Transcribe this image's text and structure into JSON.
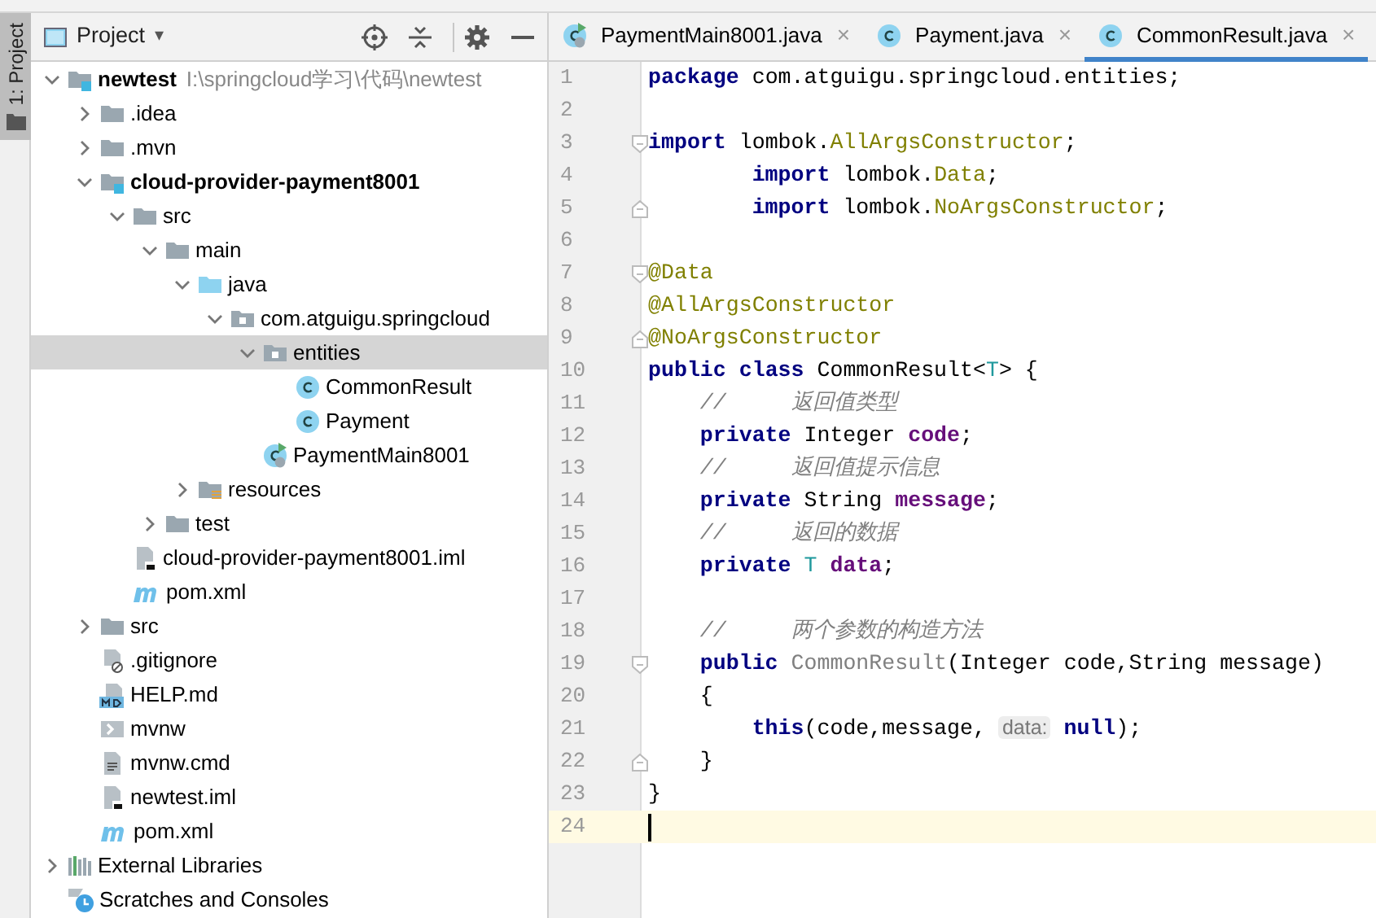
{
  "tool_strip": {
    "label": "1: Project",
    "selected": true
  },
  "project_panel": {
    "title": "Project",
    "caret": "▾",
    "tree": [
      {
        "label": "newtest",
        "path": "I:\\springcloud学习\\代码\\newtest",
        "kind": "module",
        "expanded": true,
        "selected": false,
        "children": [
          {
            "label": ".idea",
            "kind": "folder",
            "expanded": false,
            "selected": false
          },
          {
            "label": ".mvn",
            "kind": "folder",
            "expanded": false,
            "selected": false
          },
          {
            "label": "cloud-provider-payment8001",
            "kind": "module",
            "expanded": true,
            "selected": false,
            "children": [
              {
                "label": "src",
                "kind": "folder",
                "expanded": true,
                "selected": false,
                "children": [
                  {
                    "label": "main",
                    "kind": "folder",
                    "expanded": true,
                    "selected": false,
                    "children": [
                      {
                        "label": "java",
                        "kind": "source-folder",
                        "expanded": true,
                        "selected": false,
                        "children": [
                          {
                            "label": "com.atguigu.springcloud",
                            "kind": "package",
                            "expanded": true,
                            "selected": false,
                            "children": [
                              {
                                "label": "entities",
                                "kind": "package",
                                "expanded": true,
                                "selected": true,
                                "children": [
                                  {
                                    "label": "CommonResult",
                                    "kind": "class",
                                    "selected": false
                                  },
                                  {
                                    "label": "Payment",
                                    "kind": "class",
                                    "selected": false
                                  }
                                ]
                              },
                              {
                                "label": "PaymentMain8001",
                                "kind": "main-class",
                                "selected": false
                              }
                            ]
                          }
                        ]
                      },
                      {
                        "label": "resources",
                        "kind": "resources",
                        "expanded": false,
                        "selected": false
                      }
                    ]
                  },
                  {
                    "label": "test",
                    "kind": "folder",
                    "expanded": false,
                    "selected": false
                  }
                ]
              },
              {
                "label": "cloud-provider-payment8001.iml",
                "kind": "iml",
                "selected": false
              },
              {
                "label": "pom.xml",
                "kind": "maven",
                "selected": false
              }
            ]
          },
          {
            "label": "src",
            "kind": "folder",
            "expanded": false,
            "selected": false
          },
          {
            "label": ".gitignore",
            "kind": "ignore",
            "selected": false
          },
          {
            "label": "HELP.md",
            "kind": "markdown",
            "selected": false
          },
          {
            "label": "mvnw",
            "kind": "script",
            "selected": false
          },
          {
            "label": "mvnw.cmd",
            "kind": "text",
            "selected": false
          },
          {
            "label": "newtest.iml",
            "kind": "iml",
            "selected": false
          },
          {
            "label": "pom.xml",
            "kind": "maven",
            "selected": false
          }
        ]
      },
      {
        "label": "External Libraries",
        "kind": "libraries",
        "expanded": false,
        "selected": false
      },
      {
        "label": "Scratches and Consoles",
        "kind": "scratches",
        "selected": false
      }
    ]
  },
  "editor": {
    "tabs": [
      {
        "label": "PaymentMain8001.java",
        "kind": "main-class",
        "close": "×",
        "selected": false
      },
      {
        "label": "Payment.java",
        "kind": "class",
        "close": "×",
        "selected": false
      },
      {
        "label": "CommonResult.java",
        "kind": "class",
        "close": "×",
        "selected": true
      }
    ],
    "lines": [
      {
        "number": "1",
        "current": false,
        "tokens": [
          {
            "kind": "keyword",
            "text": "package"
          },
          {
            "kind": "plain",
            "text": " com.atguigu.springcloud.entities;"
          }
        ]
      },
      {
        "number": "2",
        "current": false
      },
      {
        "number": "3",
        "current": false,
        "kind": "fold-start",
        "tokens": [
          {
            "kind": "keyword",
            "text": "import"
          },
          {
            "kind": "plain",
            "text": " lombok."
          },
          {
            "kind": "annotation",
            "text": "AllArgsConstructor"
          },
          {
            "kind": "plain",
            "text": ";"
          }
        ]
      },
      {
        "number": "4",
        "current": false,
        "tokens": [
          {
            "kind": "keyword",
            "text": "        import"
          },
          {
            "kind": "plain",
            "text": " lombok."
          },
          {
            "kind": "annotation",
            "text": "Data"
          },
          {
            "kind": "plain",
            "text": ";"
          }
        ]
      },
      {
        "number": "5",
        "current": false,
        "kind": "fold-end",
        "tokens": [
          {
            "kind": "keyword",
            "text": "        import"
          },
          {
            "kind": "plain",
            "text": " lombok."
          },
          {
            "kind": "annotation",
            "text": "NoArgsConstructor"
          },
          {
            "kind": "plain",
            "text": ";"
          }
        ]
      },
      {
        "number": "6",
        "current": false
      },
      {
        "number": "7",
        "current": false,
        "kind": "fold-start",
        "tokens": [
          {
            "kind": "annotation",
            "text": "@Data"
          }
        ]
      },
      {
        "number": "8",
        "current": false,
        "tokens": [
          {
            "kind": "annotation",
            "text": "@AllArgsConstructor"
          }
        ]
      },
      {
        "number": "9",
        "current": false,
        "kind": "fold-end",
        "tokens": [
          {
            "kind": "annotation",
            "text": "@NoArgsConstructor"
          }
        ]
      },
      {
        "number": "10",
        "current": false,
        "tokens": [
          {
            "kind": "keyword",
            "text": "public class"
          },
          {
            "kind": "plain",
            "text": " CommonResult<"
          },
          {
            "kind": "type-param",
            "text": "T"
          },
          {
            "kind": "plain",
            "text": "> {"
          }
        ]
      },
      {
        "number": "11",
        "current": false,
        "tokens": [
          {
            "kind": "comment",
            "text": "    //     返回值类型"
          }
        ]
      },
      {
        "number": "12",
        "current": false,
        "tokens": [
          {
            "kind": "keyword",
            "text": "    private"
          },
          {
            "kind": "plain",
            "text": " Integer "
          },
          {
            "kind": "field",
            "text": "code"
          },
          {
            "kind": "plain",
            "text": ";"
          }
        ]
      },
      {
        "number": "13",
        "current": false,
        "tokens": [
          {
            "kind": "comment",
            "text": "    //     返回值提示信息"
          }
        ]
      },
      {
        "number": "14",
        "current": false,
        "tokens": [
          {
            "kind": "keyword",
            "text": "    private"
          },
          {
            "kind": "plain",
            "text": " String "
          },
          {
            "kind": "field",
            "text": "message"
          },
          {
            "kind": "plain",
            "text": ";"
          }
        ]
      },
      {
        "number": "15",
        "current": false,
        "tokens": [
          {
            "kind": "comment",
            "text": "    //     返回的数据"
          }
        ]
      },
      {
        "number": "16",
        "current": false,
        "tokens": [
          {
            "kind": "keyword",
            "text": "    private"
          },
          {
            "kind": "type-param",
            "text": " T"
          },
          {
            "kind": "field",
            "text": " data"
          },
          {
            "kind": "plain",
            "text": ";"
          }
        ]
      },
      {
        "number": "17",
        "current": false
      },
      {
        "number": "18",
        "current": false,
        "tokens": [
          {
            "kind": "comment",
            "text": "    //     两个参数的构造方法"
          }
        ]
      },
      {
        "number": "19",
        "current": false,
        "kind": "fold-start",
        "tokens": [
          {
            "kind": "keyword",
            "text": "    public"
          },
          {
            "kind": "unused",
            "text": " CommonResult"
          },
          {
            "kind": "plain",
            "text": "(Integer code,String message)"
          }
        ]
      },
      {
        "number": "20",
        "current": false,
        "tokens": [
          {
            "kind": "plain",
            "text": "    {"
          }
        ]
      },
      {
        "number": "21",
        "current": false,
        "tokens": [
          {
            "kind": "keyword",
            "text": "        this"
          },
          {
            "kind": "plain",
            "text": "(code,message, "
          },
          {
            "kind": "hint",
            "text": "data:"
          },
          {
            "kind": "keyword",
            "text": " null"
          },
          {
            "kind": "plain",
            "text": ");"
          }
        ]
      },
      {
        "number": "22",
        "current": false,
        "kind": "fold-end",
        "tokens": [
          {
            "kind": "plain",
            "text": "    }"
          }
        ]
      },
      {
        "number": "23",
        "current": false,
        "tokens": [
          {
            "kind": "plain",
            "text": "}"
          }
        ]
      },
      {
        "number": "24",
        "current": true
      }
    ]
  }
}
